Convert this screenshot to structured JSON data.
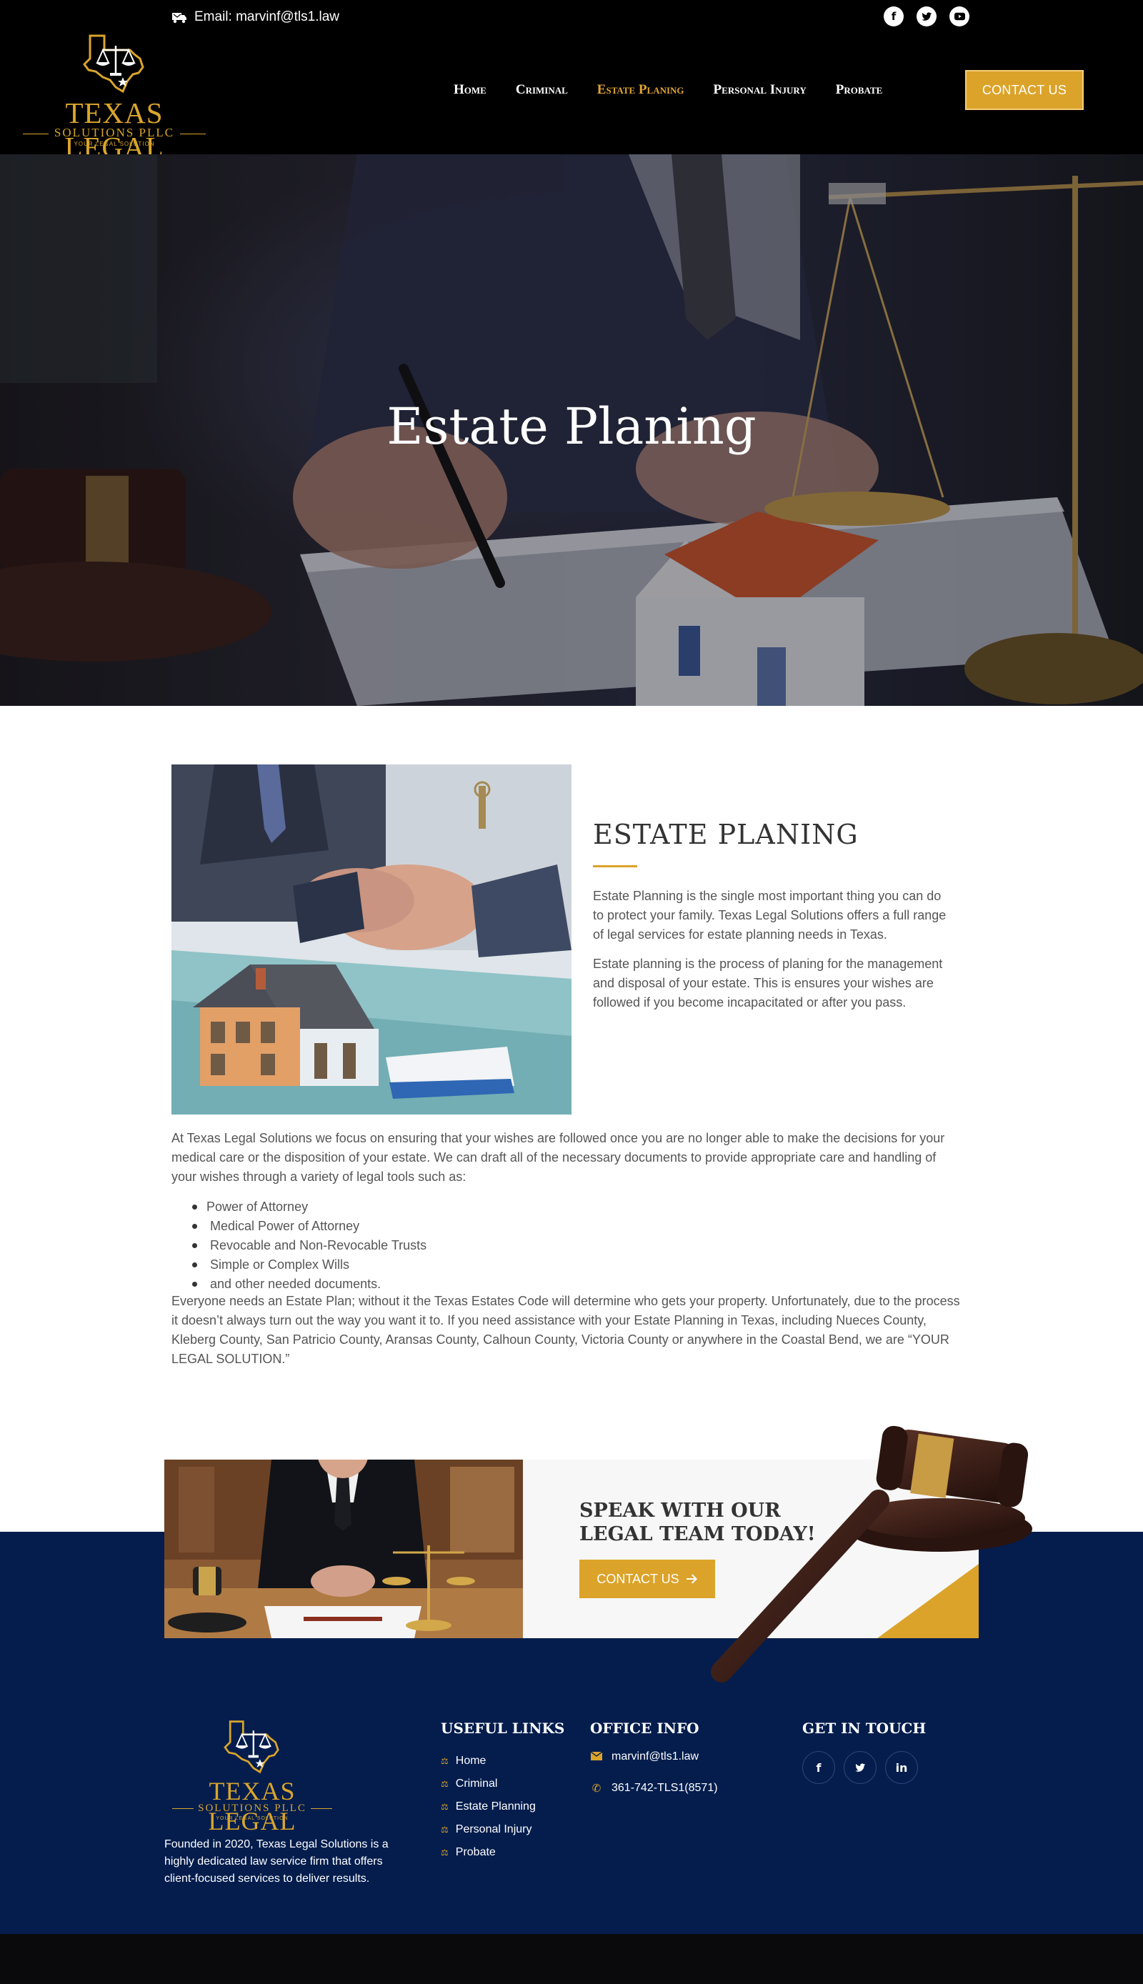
{
  "header": {
    "email_label": "Email: marvinf@tls1.law",
    "social_icons": [
      "facebook-icon",
      "twitter-icon",
      "youtube-icon"
    ],
    "logo": {
      "title": "TEXAS LEGAL",
      "subtitle": "SOLUTIONS PLLC",
      "tagline": "YOUR LEGAL SOLUTION"
    },
    "nav": [
      {
        "label": "Home",
        "active": false
      },
      {
        "label": "Criminal",
        "active": false
      },
      {
        "label": "Estate Planing",
        "active": true
      },
      {
        "label": "Personal Injury",
        "active": false
      },
      {
        "label": "Probate",
        "active": false
      }
    ],
    "cta_label": "CONTACT US"
  },
  "hero": {
    "title": "Estate Planing"
  },
  "content": {
    "heading": "ESTATE PLANING",
    "intro_1": "Estate Planning is the single most important thing you can do to protect your family. Texas Legal Solutions offers a full range of legal services for estate planning needs in Texas.",
    "intro_2": "Estate planning is the process of planing for the management and disposal of your estate. This is ensures your wishes are followed if you become incapacitated or after you pass.",
    "body_1": "At Texas Legal Solutions we focus on ensuring that your wishes are followed once you are no longer able to make the decisions for your medical care or the disposition of your estate. We can draft all of the necessary documents to provide appropriate care and handling of your wishes through a variety of legal tools such as:",
    "bullets": [
      "Power of Attorney",
      " Medical Power of Attorney",
      " Revocable and Non-Revocable Trusts",
      " Simple or Complex Wills",
      " and other needed documents."
    ],
    "body_2": "Everyone needs an Estate Plan; without it the Texas Estates Code will determine who gets your property. Unfortunately, due to the process it doesn’t always turn out the way you want it to. If you need assistance with your Estate Planning in Texas, including Nueces County, Kleberg County, San Patricio County, Aransas County, Calhoun County, Victoria County or anywhere in the Coastal Bend, we are “YOUR LEGAL SOLUTION.”"
  },
  "cta": {
    "heading": "SPEAK WITH OUR LEGAL TEAM TODAY!",
    "button_label": "CONTACT US",
    "button_icon": "arrow-right-icon"
  },
  "footer": {
    "logo": {
      "title": "TEXAS LEGAL",
      "subtitle": "SOLUTIONS PLLC",
      "tagline": "YOUR LEGAL SOLUTION"
    },
    "about": "Founded in 2020, Texas Legal Solutions is a highly dedicated law service firm that offers client-focused services to deliver results.",
    "useful_links_heading": "USEFUL LINKS",
    "useful_links": [
      "Home",
      "Criminal",
      "Estate Planning",
      "Personal Injury",
      "Probate"
    ],
    "office_heading": "OFFICE INFO",
    "office_email": "marvinf@tls1.law",
    "office_phone": "361-742-TLS1(8571)",
    "touch_heading": "GET IN TOUCH",
    "social_icons": [
      "facebook-icon",
      "twitter-icon",
      "linkedin-icon"
    ]
  },
  "colors": {
    "accent": "#dca32a",
    "navy": "#041d4d",
    "black": "#000000"
  }
}
